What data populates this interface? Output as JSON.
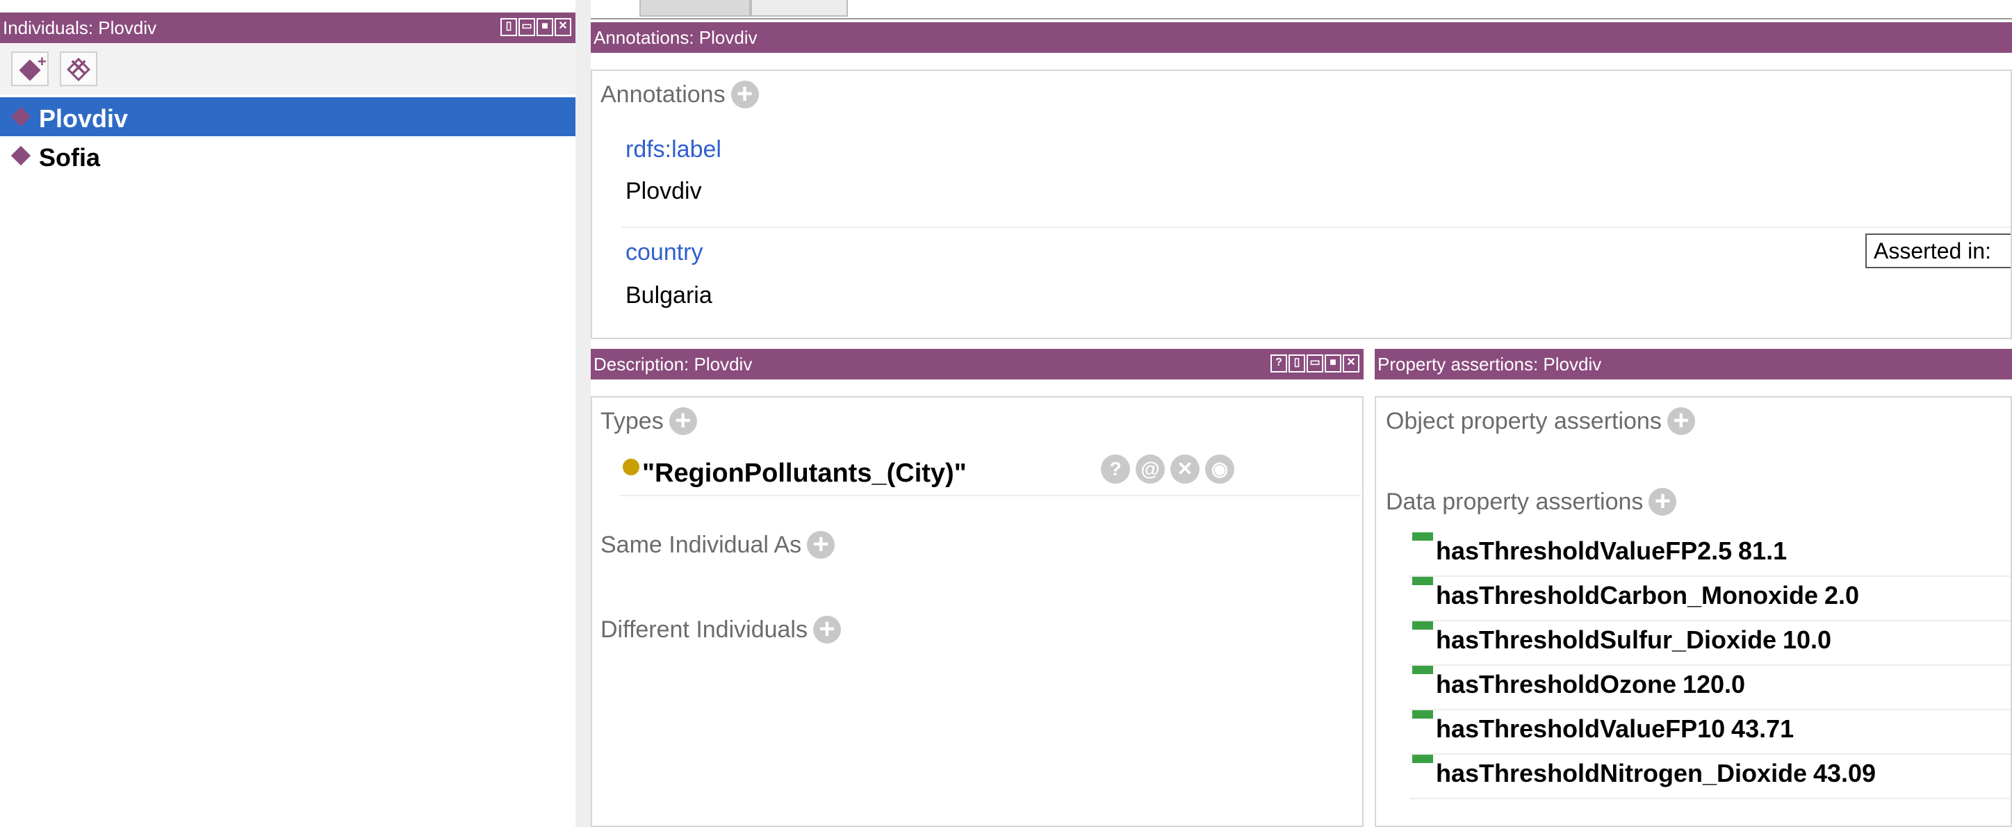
{
  "individuals": {
    "title": "Individuals: Plovdiv",
    "items": [
      {
        "label": "Plovdiv",
        "selected": true
      },
      {
        "label": "Sofia",
        "selected": false
      }
    ]
  },
  "annotations": {
    "title": "Annotations: Plovdiv",
    "header": "Annotations",
    "entries": [
      {
        "property": "rdfs:label",
        "value": "Plovdiv"
      },
      {
        "property": "country",
        "value": "Bulgaria"
      }
    ],
    "tooltip": "Asserted in:"
  },
  "description": {
    "title": "Description: Plovdiv",
    "types_header": "Types",
    "type_value": "\"RegionPollutants_(City)\"",
    "same_header": "Same Individual As",
    "different_header": "Different Individuals"
  },
  "property_assertions": {
    "title": "Property assertions: Plovdiv",
    "object_header": "Object property assertions",
    "data_header": "Data property assertions",
    "data_items": [
      {
        "property": "hasThresholdValueFP2.5",
        "value": "81.1"
      },
      {
        "property": "hasThresholdCarbon_Monoxide",
        "value": "2.0"
      },
      {
        "property": "hasThresholdSulfur_Dioxide",
        "value": "10.0"
      },
      {
        "property": "hasThresholdOzone",
        "value": "120.0"
      },
      {
        "property": "hasThresholdValueFP10",
        "value": "43.71"
      },
      {
        "property": "hasThresholdNitrogen_Dioxide",
        "value": "43.09"
      }
    ]
  },
  "colors": {
    "titlebar": "#8a4b7d",
    "selection": "#2e6bc6",
    "property_link": "#2f5fd0",
    "type_dot": "#c9a000",
    "data_bar": "#3aa043"
  },
  "icons": [
    "add-individual-icon",
    "delete-individual-icon",
    "individual-diamond-icon",
    "add-icon",
    "explain-icon",
    "annotate-icon",
    "delete-icon",
    "edit-icon",
    "data-property-icon"
  ]
}
